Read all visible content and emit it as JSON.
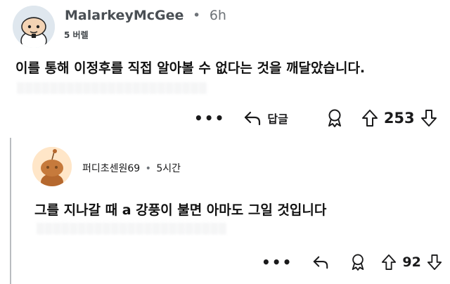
{
  "comment1": {
    "username": "MalarkeyMcGee",
    "separator": "•",
    "time": "6h",
    "flair": "5 버렐",
    "body": "이를 통해 이정후를 직접 알아볼 수 없다는 것을 깨달았습니다.",
    "more_label": "•••",
    "reply_label": "답글",
    "score": "253"
  },
  "reply1": {
    "username": "퍼디초센원69",
    "separator": "•",
    "time": "5시간",
    "body": "그를 지나갈 때 a 강풍이 불면 아마도 그일 것입니다",
    "more_label": "•••",
    "score": "92"
  }
}
